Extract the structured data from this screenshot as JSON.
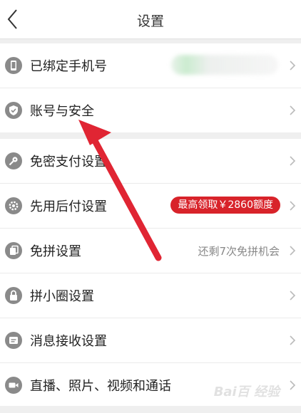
{
  "header": {
    "title": "设置"
  },
  "group1": [
    {
      "label": "已绑定手机号"
    },
    {
      "label": "账号与安全"
    }
  ],
  "group2": [
    {
      "label": "免密支付设置"
    },
    {
      "label": "先用后付设置",
      "badge": "最高领取￥2860额度"
    },
    {
      "label": "免拼设置",
      "side_text": "还剩7次免拼机会"
    },
    {
      "label": "拼小圈设置"
    },
    {
      "label": "消息接收设置"
    },
    {
      "label": "直播、照片、视频和通话"
    }
  ],
  "watermark": "Bai百 经验",
  "colors": {
    "badge": "#d8232a",
    "arrow": "#e02533",
    "icon": "#8a8a8a"
  },
  "icons": {
    "back": "chevron-left-icon",
    "phone": "phone-icon",
    "shield": "shield-icon",
    "key": "key-icon",
    "gear": "gear-icon",
    "group": "copy-icon",
    "lock": "lock-icon",
    "message": "message-icon",
    "video": "video-camera-icon"
  }
}
